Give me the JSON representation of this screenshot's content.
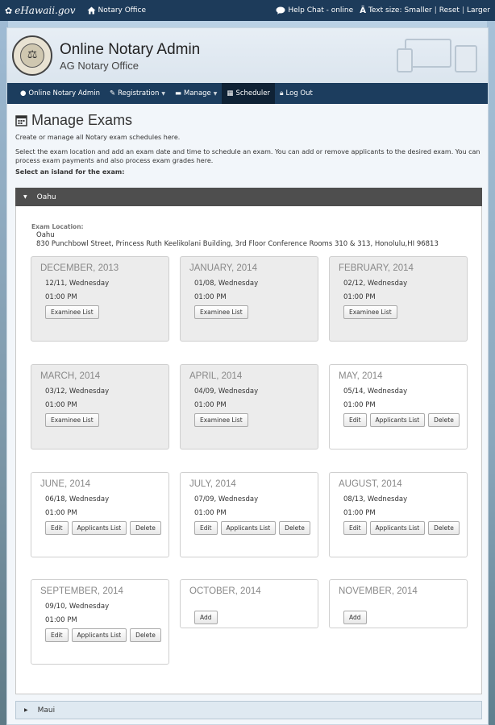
{
  "topbar": {
    "brand": "eHawaii.gov",
    "office_link": "Notary Office",
    "help_chat": "Help Chat - online",
    "text_size_label": "Text size:",
    "text_size_options": [
      "Smaller",
      "Reset",
      "Larger"
    ],
    "separator": "|"
  },
  "header": {
    "title": "Online Notary Admin",
    "subtitle": "AG Notary Office"
  },
  "nav": {
    "items": [
      "Online Notary Admin",
      "Registration",
      "Manage",
      "Scheduler",
      "Log Out"
    ],
    "active": "Scheduler"
  },
  "page": {
    "title": "Manage Exams",
    "intro": "Create or manage all Notary exam schedules here.",
    "instructions": "Select the exam location and add an exam date and time to schedule an exam. You can add or remove applicants to the desired exam. You can process exam payments and also process exam grades here.",
    "island_prompt": "Select an island for the exam:"
  },
  "islands": [
    {
      "name": "Oahu",
      "expanded": true
    },
    {
      "name": "Maui",
      "expanded": false
    }
  ],
  "location": {
    "label": "Exam Location:",
    "name": "Oahu",
    "address": "830 Punchbowl Street, Princess Ruth Keelikolani Building, 3rd Floor Conference Rooms 310 & 313, Honolulu,HI 96813"
  },
  "buttons": {
    "examinee_list": "Examinee List",
    "edit": "Edit",
    "applicants_list": "Applicants List",
    "delete": "Delete",
    "add": "Add"
  },
  "exams": [
    {
      "month": "DECEMBER, 2013",
      "date": "12/11, Wednesday",
      "time": "01:00 PM",
      "status": "past"
    },
    {
      "month": "JANUARY, 2014",
      "date": "01/08, Wednesday",
      "time": "01:00 PM",
      "status": "past"
    },
    {
      "month": "FEBRUARY, 2014",
      "date": "02/12, Wednesday",
      "time": "01:00 PM",
      "status": "past"
    },
    {
      "month": "MARCH, 2014",
      "date": "03/12, Wednesday",
      "time": "01:00 PM",
      "status": "past"
    },
    {
      "month": "APRIL, 2014",
      "date": "04/09, Wednesday",
      "time": "01:00 PM",
      "status": "past"
    },
    {
      "month": "MAY, 2014",
      "date": "05/14, Wednesday",
      "time": "01:00 PM",
      "status": "scheduled"
    },
    {
      "month": "JUNE, 2014",
      "date": "06/18, Wednesday",
      "time": "01:00 PM",
      "status": "scheduled"
    },
    {
      "month": "JULY, 2014",
      "date": "07/09, Wednesday",
      "time": "01:00 PM",
      "status": "scheduled"
    },
    {
      "month": "AUGUST, 2014",
      "date": "08/13, Wednesday",
      "time": "01:00 PM",
      "status": "scheduled"
    },
    {
      "month": "SEPTEMBER, 2014",
      "date": "09/10, Wednesday",
      "time": "01:00 PM",
      "status": "scheduled"
    },
    {
      "month": "OCTOBER, 2014",
      "date": "",
      "time": "",
      "status": "empty"
    },
    {
      "month": "NOVEMBER, 2014",
      "date": "",
      "time": "",
      "status": "empty"
    }
  ],
  "icons": {
    "brand": "hawaii-flower-icon",
    "office": "home-icon",
    "chat": "chat-bubble-icon",
    "text_size": "text-size-icon",
    "calendar": "calendar-icon"
  },
  "colors": {
    "topbar": "#1d3b5a",
    "nav": "#1c3d5e",
    "nav_active": "#0f2235",
    "accordion_open": "#4e4e4e",
    "past_card": "#ececec"
  }
}
